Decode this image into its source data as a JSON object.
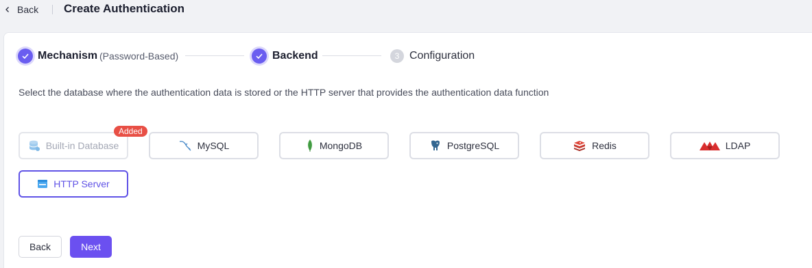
{
  "header": {
    "back_label": "Back",
    "title": "Create Authentication"
  },
  "steps": [
    {
      "title": "Mechanism",
      "subtitle": "(Password-Based)",
      "state": "done"
    },
    {
      "title": "Backend",
      "state": "done"
    },
    {
      "number": "3",
      "title": "Configuration",
      "state": "pending"
    }
  ],
  "description": "Select the database where the authentication data is stored or the HTTP server that provides the authentication data function",
  "options": [
    {
      "label": "Built-in Database",
      "icon": "database-icon",
      "state": "disabled",
      "badge": "Added"
    },
    {
      "label": "MySQL",
      "icon": "mysql-dolphin-icon",
      "state": "normal"
    },
    {
      "label": "MongoDB",
      "icon": "mongodb-leaf-icon",
      "state": "normal"
    },
    {
      "label": "PostgreSQL",
      "icon": "postgresql-elephant-icon",
      "state": "normal"
    },
    {
      "label": "Redis",
      "icon": "redis-cube-icon",
      "state": "normal"
    },
    {
      "label": "LDAP",
      "icon": "ldap-logo-icon",
      "state": "normal"
    },
    {
      "label": "HTTP Server",
      "icon": "http-server-icon",
      "state": "selected"
    }
  ],
  "footer": {
    "back_label": "Back",
    "next_label": "Next"
  },
  "colors": {
    "accent": "#6a5df0",
    "selected_border": "#5f52e6",
    "badge": "#e84f45",
    "primary_button": "#6b50f0"
  }
}
